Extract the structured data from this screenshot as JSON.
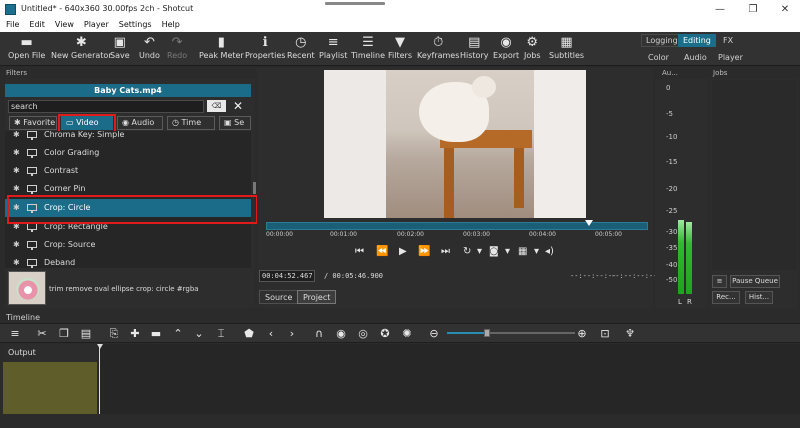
{
  "window": {
    "title": "Untitled* - 640x360 30.00fps 2ch - Shotcut",
    "minimize": "—",
    "maximize": "❐",
    "close": "✕"
  },
  "menu": [
    "File",
    "Edit",
    "View",
    "Player",
    "Settings",
    "Help"
  ],
  "toolbar": [
    {
      "label": "Open File",
      "icon": "▬"
    },
    {
      "label": "New Generator",
      "icon": "✱"
    },
    {
      "label": "Save",
      "icon": "▣"
    },
    {
      "label": "Undo",
      "icon": "↶"
    },
    {
      "label": "Redo",
      "icon": "↷"
    },
    {
      "label": "Peak Meter",
      "icon": "▮"
    },
    {
      "label": "Properties",
      "icon": "ℹ"
    },
    {
      "label": "Recent",
      "icon": "◷"
    },
    {
      "label": "Playlist",
      "icon": "≡"
    },
    {
      "label": "Timeline",
      "icon": "☰"
    },
    {
      "label": "Filters",
      "icon": "▼"
    },
    {
      "label": "Keyframes",
      "icon": "⏱"
    },
    {
      "label": "History",
      "icon": "▤"
    },
    {
      "label": "Export",
      "icon": "◉"
    },
    {
      "label": "Jobs",
      "icon": "⚙"
    },
    {
      "label": "Subtitles",
      "icon": "▦"
    }
  ],
  "layouts": {
    "logging": "Logging",
    "editing": "Editing",
    "fx": "FX",
    "color": "Color",
    "audio": "Audio",
    "player": "Player"
  },
  "filters": {
    "header": "Filters",
    "clip_name": "Baby Cats.mp4",
    "search_value": "search",
    "tabs": {
      "favorite": "Favorite",
      "video": "Video",
      "audio": "Audio",
      "time": "Time",
      "sets": "Se"
    },
    "items": [
      "Chroma Key: Simple",
      "Color Grading",
      "Contrast",
      "Corner Pin",
      "Crop: Circle",
      "Crop: Rectangle",
      "Crop: Source",
      "Deband"
    ],
    "selected": "Crop: Circle",
    "description": "trim remove oval ellipse crop: circle #rgba"
  },
  "player": {
    "timecodes": [
      "00:00:00",
      "00:01:00",
      "00:02:00",
      "00:03:00",
      "00:04:00",
      "00:05:00"
    ],
    "current_time": "00:04:52.467",
    "duration": "/ 00:05:46.900",
    "in_point": "--:--:--:--",
    "out_point": "--:--:--:--",
    "tabs": {
      "source": "Source",
      "project": "Project"
    }
  },
  "audio_meter": {
    "header": "Au...",
    "scale": [
      "0",
      "-5",
      "-10",
      "-15",
      "-20",
      "-25",
      "-30",
      "-35",
      "-40",
      "-50"
    ],
    "left": "L",
    "right": "R"
  },
  "jobs": {
    "header": "Jobs",
    "pause_queue": "Pause Queue",
    "recent": "Rec...",
    "history": "Hist...",
    "menu": "≡"
  },
  "timeline": {
    "header": "Timeline",
    "track": "Output"
  }
}
